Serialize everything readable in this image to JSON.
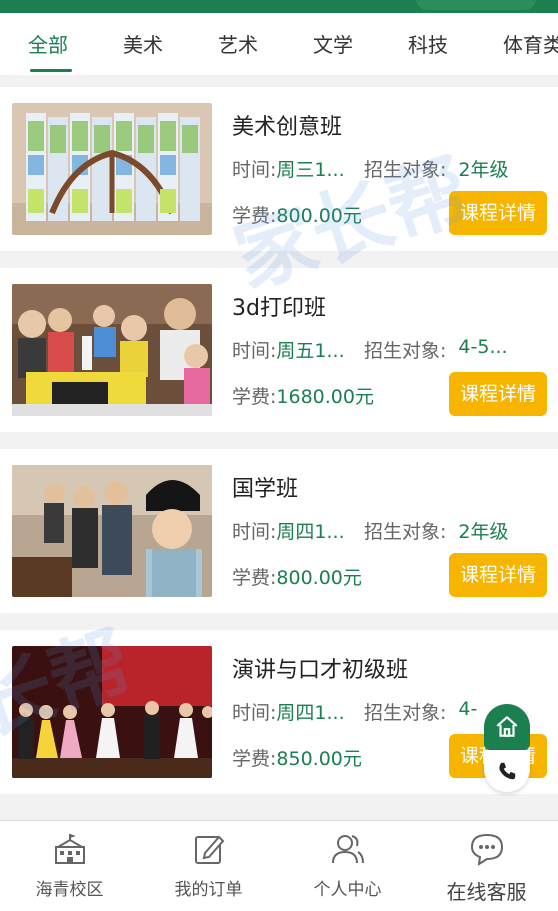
{
  "tabs": [
    "全部",
    "美术",
    "艺术",
    "文学",
    "科技",
    "体育类"
  ],
  "active_tab_index": 0,
  "watermark": [
    "家长帮",
    "长帮"
  ],
  "courses": [
    {
      "title": "美术创意班",
      "time_label": "时间:",
      "time_value": "周三1...",
      "target_label": "招生对象:",
      "target_value": "2年级",
      "fee_label": "学费:",
      "fee_value": "800.00元",
      "button": "课程详情"
    },
    {
      "title": "3d打印班",
      "time_label": "时间:",
      "time_value": "周五1...",
      "target_label": "招生对象:",
      "target_value": "4-5...",
      "fee_label": "学费:",
      "fee_value": "1680.00元",
      "button": "课程详情"
    },
    {
      "title": "国学班",
      "time_label": "时间:",
      "time_value": "周四1...",
      "target_label": "招生对象:",
      "target_value": "2年级",
      "fee_label": "学费:",
      "fee_value": "800.00元",
      "button": "课程详情"
    },
    {
      "title": "演讲与口才初级班",
      "time_label": "时间:",
      "time_value": "周四1...",
      "target_label": "招生对象:",
      "target_value": "4-",
      "fee_label": "学费:",
      "fee_value": "850.00元",
      "button": "课程详情"
    }
  ],
  "bottom_nav": [
    {
      "label": "海青校区",
      "icon": "school-icon"
    },
    {
      "label": "我的订单",
      "icon": "edit-order-icon"
    },
    {
      "label": "个人中心",
      "icon": "users-icon"
    },
    {
      "label": "在线客服",
      "icon": "chat-icon"
    }
  ],
  "float_buttons": {
    "home_icon": "home-icon",
    "phone_icon": "phone-icon"
  },
  "colors": {
    "brand_green": "#1b7f4f",
    "button_yellow": "#f7b500",
    "watermark_blue": "#5a96e6"
  }
}
